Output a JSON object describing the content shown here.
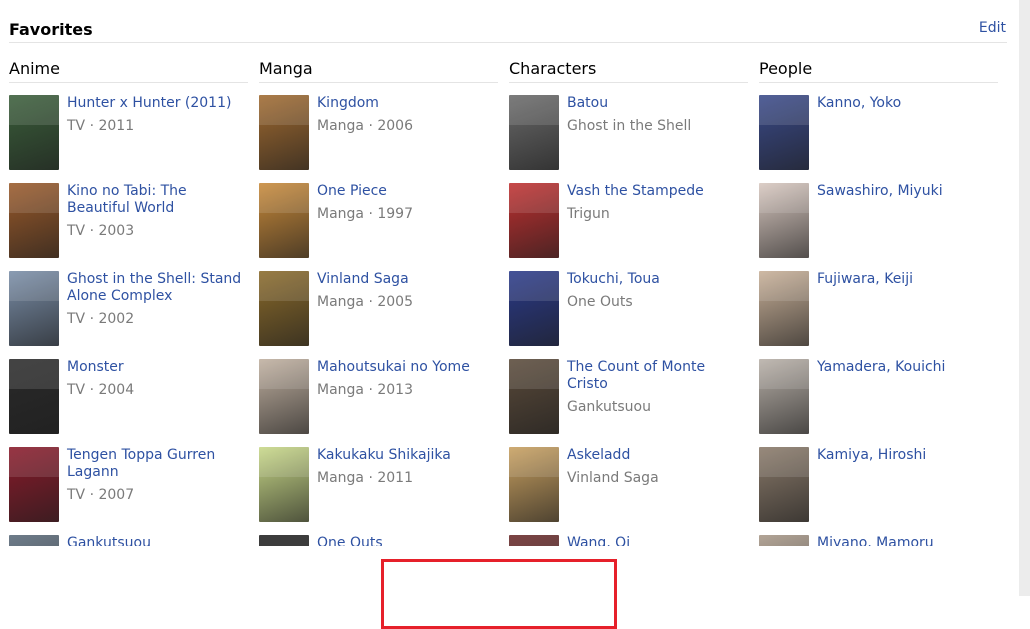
{
  "favorites": {
    "title": "Favorites",
    "edit_label": "Edit",
    "columns": [
      {
        "header": "Anime",
        "items": [
          {
            "name": "Hunter x Hunter (2011)",
            "meta": "TV · 2011",
            "color": "#3a5e3a"
          },
          {
            "name": "Kino no Tabi: The Beautiful World",
            "meta": "TV · 2003",
            "color": "#9a5a2a"
          },
          {
            "name": "Ghost in the Shell: Stand Alone Complex",
            "meta": "TV · 2002",
            "color": "#7a8ea8"
          },
          {
            "name": "Monster",
            "meta": "TV · 2004",
            "color": "#2a2a2a"
          },
          {
            "name": "Tengen Toppa Gurren Lagann",
            "meta": "TV · 2007",
            "color": "#8a1a2a"
          },
          {
            "name": "Gankutsuou",
            "meta": "",
            "color": "#5a6a7a"
          }
        ]
      },
      {
        "header": "Manga",
        "items": [
          {
            "name": "Kingdom",
            "meta": "Manga · 2006",
            "color": "#a06a30"
          },
          {
            "name": "One Piece",
            "meta": "Manga · 1997",
            "color": "#c88a3a"
          },
          {
            "name": "Vinland Saga",
            "meta": "Manga · 2005",
            "color": "#8a6a2a"
          },
          {
            "name": "Mahoutsukai no Yome",
            "meta": "Manga · 2013",
            "color": "#c0b0a0"
          },
          {
            "name": "Kakukaku Shikajika",
            "meta": "Manga · 2011",
            "color": "#c8d888"
          },
          {
            "name": "One Outs",
            "meta": "",
            "color": "#222222"
          }
        ]
      },
      {
        "header": "Characters",
        "items": [
          {
            "name": "Batou",
            "meta": "Ghost in the Shell",
            "color": "#6a6a6a"
          },
          {
            "name": "Vash the Stampede",
            "meta": "Trigun",
            "color": "#c03030"
          },
          {
            "name": "Tokuchi, Toua",
            "meta": "One Outs",
            "color": "#2a3a8a"
          },
          {
            "name": "The Count of Monte Cristo",
            "meta": "Gankutsuou",
            "color": "#5a4a3a"
          },
          {
            "name": "Askeladd",
            "meta": "Vinland Saga",
            "color": "#c8a060"
          },
          {
            "name": "Wang, Qi",
            "meta": "",
            "color": "#6a2a2a"
          }
        ]
      },
      {
        "header": "People",
        "items": [
          {
            "name": "Kanno, Yoko",
            "meta": "",
            "color": "#3a4a8a"
          },
          {
            "name": "Sawashiro, Miyuki",
            "meta": "",
            "color": "#d8c8c0"
          },
          {
            "name": "Fujiwara, Keiji",
            "meta": "",
            "color": "#c8b098"
          },
          {
            "name": "Yamadera, Kouichi",
            "meta": "",
            "color": "#b8b0a8"
          },
          {
            "name": "Kamiya, Hiroshi",
            "meta": "",
            "color": "#8a7a6a"
          },
          {
            "name": "Miyano, Mamoru",
            "meta": "",
            "color": "#a89888"
          }
        ]
      }
    ]
  }
}
